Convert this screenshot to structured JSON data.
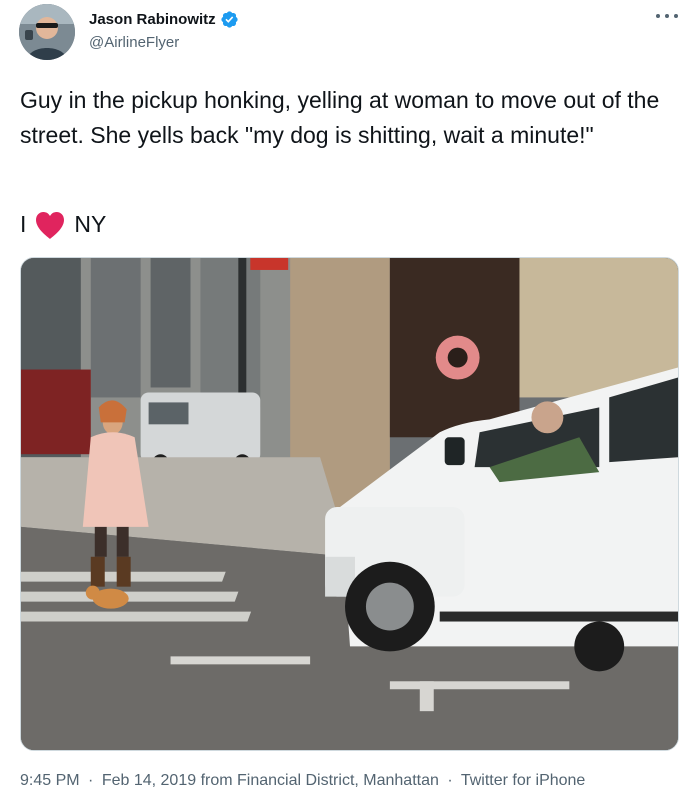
{
  "author": {
    "display_name": "Jason Rabinowitz",
    "handle": "@AirlineFlyer",
    "icons": {
      "avatar": "profile-photo",
      "verified": "verified-badge-icon",
      "more": "more-options-icon"
    },
    "verified_color": "#1d9bf0"
  },
  "tweet": {
    "text": "Guy in the pickup honking, yelling at woman to move out of the street. She yells back \"my dog is shitting, wait a minute!\"",
    "love_prefix": "I",
    "love_suffix": "NY",
    "heart_icon": "red-heart-emoji",
    "heart_color": "#e0245e"
  },
  "media": {
    "kind": "photo",
    "description_icon": "street-photo"
  },
  "meta": {
    "time": "9:45 PM",
    "date": "Feb 14, 2019",
    "location": "from Financial District, Manhattan",
    "source": "Twitter for iPhone",
    "separator": "·"
  },
  "colors": {
    "text_primary": "#0f1419",
    "text_secondary": "#536471",
    "border": "#cfd9de"
  }
}
